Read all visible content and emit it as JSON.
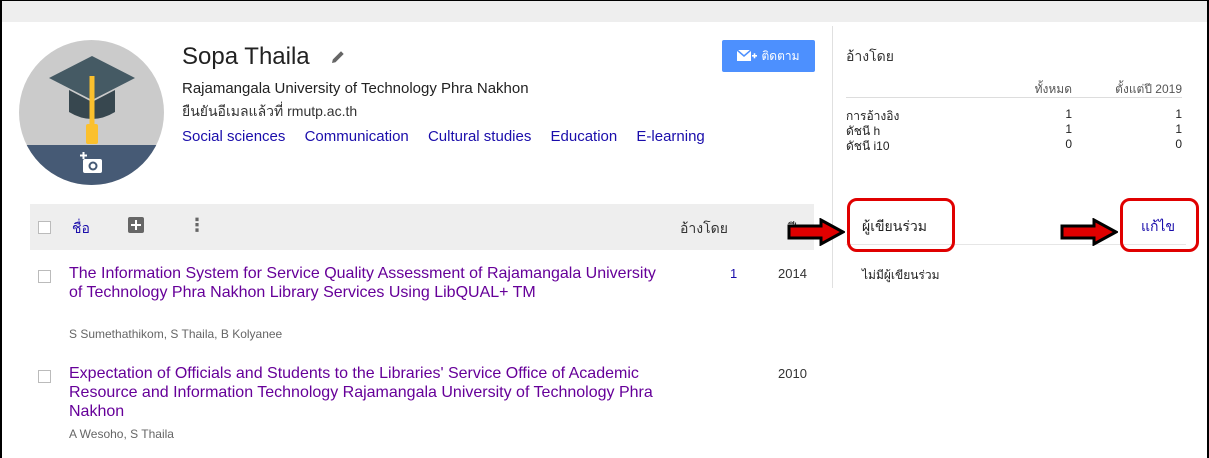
{
  "profile": {
    "name": "Sopa Thaila",
    "affiliation": "Rajamangala University of Technology Phra Nakhon",
    "verified_email": "ยืนยันอีเมลแล้วที่ rmutp.ac.th",
    "interests": [
      "Social sciences",
      "Communication",
      "Cultural studies",
      "Education",
      "E-learning"
    ],
    "follow_label": "ติดตาม"
  },
  "table": {
    "title_label": "ชื่อ",
    "cited_by_label": "อ้างโดย",
    "year_label": "ปี"
  },
  "articles": [
    {
      "title": "The Information System for Service Quality Assessment of Rajamangala University of Technology Phra Nakhon Library Services Using LibQUAL+ TM",
      "authors": "S Sumethathikom, S Thaila, B Kolyanee",
      "cites": "1",
      "year": "2014"
    },
    {
      "title": "Expectation of Officials and Students to the Libraries' Service Office of Academic Resource and Information Technology Rajamangala University of Technology Phra Nakhon",
      "authors": "A Wesoho, S Thaila",
      "cites": "",
      "year": "2010"
    }
  ],
  "cited_by": {
    "heading": "อ้างโดย",
    "col_all": "ทั้งหมด",
    "col_since": "ตั้งแต่ปี 2019",
    "rows": [
      {
        "label": "การอ้างอิง",
        "all": "1",
        "since": "1"
      },
      {
        "label": "ดัชนี h",
        "all": "1",
        "since": "1"
      },
      {
        "label": "ดัชนี i10",
        "all": "0",
        "since": "0"
      }
    ]
  },
  "coauthors": {
    "title": "ผู้เขียนร่วม",
    "edit_label": "แก้ไข",
    "empty_text": "ไม่มีผู้เขียนร่วม"
  },
  "colors": {
    "link": "#1a0dab",
    "article_title": "#660099",
    "follow_button": "#4d90fe",
    "annotation_red": "#e00000"
  }
}
